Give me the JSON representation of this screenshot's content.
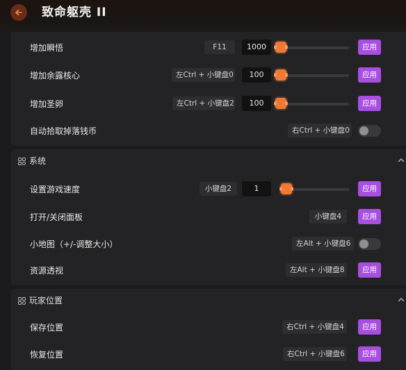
{
  "header": {
    "title": "致命躯壳 II"
  },
  "top_section": {
    "rows": [
      {
        "label": "增加瞬悟",
        "hotkey": "F11",
        "value": "1000",
        "apply": "应用"
      },
      {
        "label": "增加余露核心",
        "hotkey": "左Ctrl + 小键盘0",
        "value": "100",
        "apply": "应用"
      },
      {
        "label": "增加圣卵",
        "hotkey": "左Ctrl + 小键盘2",
        "value": "100",
        "apply": "应用"
      },
      {
        "label": "自动拾取掉落钱币",
        "hotkey": "右Ctrl + 小键盘0",
        "toggle": false
      }
    ]
  },
  "system": {
    "title": "系统",
    "rows": [
      {
        "label": "设置游戏速度",
        "hotkey": "小键盘2",
        "value": "1",
        "apply": "应用"
      },
      {
        "label": "打开/关闭面板",
        "hotkey": "小键盘4",
        "apply": "应用"
      },
      {
        "label": "小地图（+/-调整大小）",
        "hotkey": "左Alt + 小键盘6",
        "toggle": false
      },
      {
        "label": "资源透视",
        "hotkey": "左Alt + 小键盘8",
        "apply": "应用"
      }
    ]
  },
  "player_position": {
    "title": "玩家位置",
    "rows": [
      {
        "label": "保存位置",
        "hotkey": "右Ctrl + 小键盘4",
        "apply": "应用"
      },
      {
        "label": "恢复位置",
        "hotkey": "右Ctrl + 小键盘6",
        "apply": "应用"
      }
    ]
  },
  "colors": {
    "accent": "#a84ee0",
    "slider": "#f07a34",
    "background": "#1b1b1d",
    "panel": "#232325"
  },
  "icons": {
    "back": "back-arrow-icon",
    "section": "grid-icon",
    "collapse": "chevron-up-icon"
  }
}
